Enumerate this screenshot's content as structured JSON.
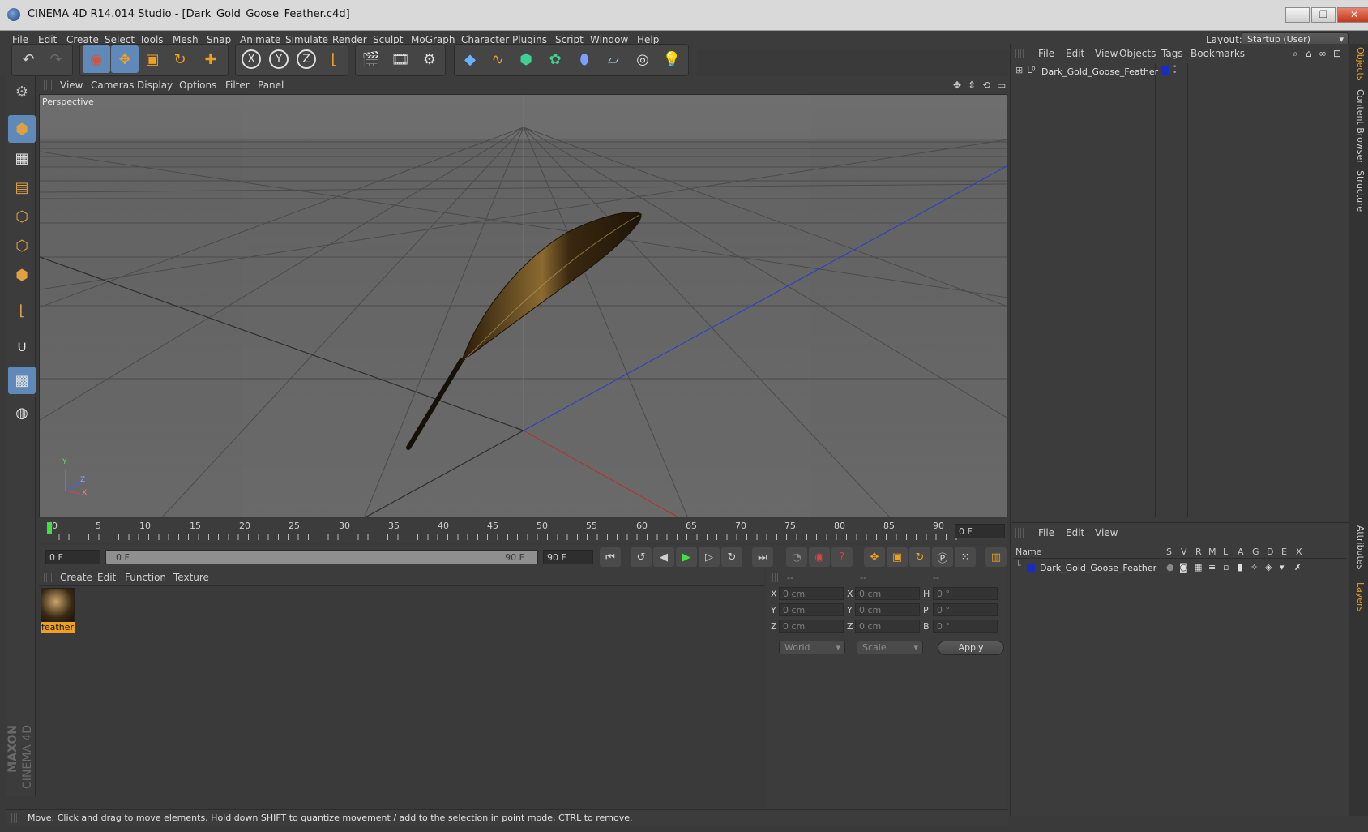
{
  "window": {
    "title": "CINEMA 4D R14.014 Studio - [Dark_Gold_Goose_Feather.c4d]",
    "controls": [
      "–",
      "❐",
      "✕"
    ]
  },
  "menubar": {
    "items": [
      "File",
      "Edit",
      "Create",
      "Select",
      "Tools",
      "Mesh",
      "Snap",
      "Animate",
      "Simulate",
      "Render",
      "Sculpt",
      "MoGraph",
      "Character",
      "Plugins",
      "Script",
      "Window",
      "Help"
    ],
    "layout_label": "Layout:",
    "layout_value": "Startup (User)"
  },
  "toolbar": {
    "axis_labels": [
      "X",
      "Y",
      "Z"
    ]
  },
  "viewport": {
    "menu": [
      "View",
      "Cameras",
      "Display",
      "Options",
      "Filter",
      "Panel"
    ],
    "camera_label": "Perspective",
    "axis_y": "Y",
    "axis_z": "Z",
    "axis_x": "X"
  },
  "timeline": {
    "ticks": [
      "0",
      "5",
      "10",
      "15",
      "20",
      "25",
      "30",
      "35",
      "40",
      "45",
      "50",
      "55",
      "60",
      "65",
      "70",
      "75",
      "80",
      "85",
      "90"
    ],
    "current_frame": "0 F",
    "start_field": "0 F",
    "range_start": "0 F",
    "range_end": "90 F",
    "end_field": "90 F"
  },
  "material_manager": {
    "menu": [
      "Create",
      "Edit",
      "Function",
      "Texture"
    ],
    "material_name": "feather"
  },
  "coordinates": {
    "headers": [
      "--",
      "--",
      "--"
    ],
    "rows": [
      {
        "l1": "X",
        "v1": "0 cm",
        "l2": "X",
        "v2": "0 cm",
        "l3": "H",
        "v3": "0 °"
      },
      {
        "l1": "Y",
        "v1": "0 cm",
        "l2": "Y",
        "v2": "0 cm",
        "l3": "P",
        "v3": "0 °"
      },
      {
        "l1": "Z",
        "v1": "0 cm",
        "l2": "Z",
        "v2": "0 cm",
        "l3": "B",
        "v3": "0 °"
      }
    ],
    "space": "World",
    "mode": "Scale",
    "apply_label": "Apply"
  },
  "object_manager": {
    "menu": [
      "File",
      "Edit",
      "View",
      "Objects",
      "Tags",
      "Bookmarks"
    ],
    "object_name": "Dark_Gold_Goose_Feather"
  },
  "layer_manager": {
    "menu": [
      "File",
      "Edit",
      "View"
    ],
    "columns": [
      "Name",
      "S",
      "V",
      "R",
      "M",
      "L",
      "A",
      "G",
      "D",
      "E",
      "X"
    ],
    "layer_name": "Dark_Gold_Goose_Feather"
  },
  "right_tabs": [
    "Objects",
    "Content Browser",
    "Structure",
    "Attributes",
    "Layers"
  ],
  "status": {
    "text": "Move: Click and drag to move elements. Hold down SHIFT to quantize movement / add to the selection in point mode, CTRL to remove."
  },
  "brand": {
    "line1": "MAXON",
    "line2": "CINEMA 4D"
  },
  "colors": {
    "accent": "#5f89b8",
    "material_label": "#f0a020",
    "layer_color": "#1a2cc8"
  }
}
